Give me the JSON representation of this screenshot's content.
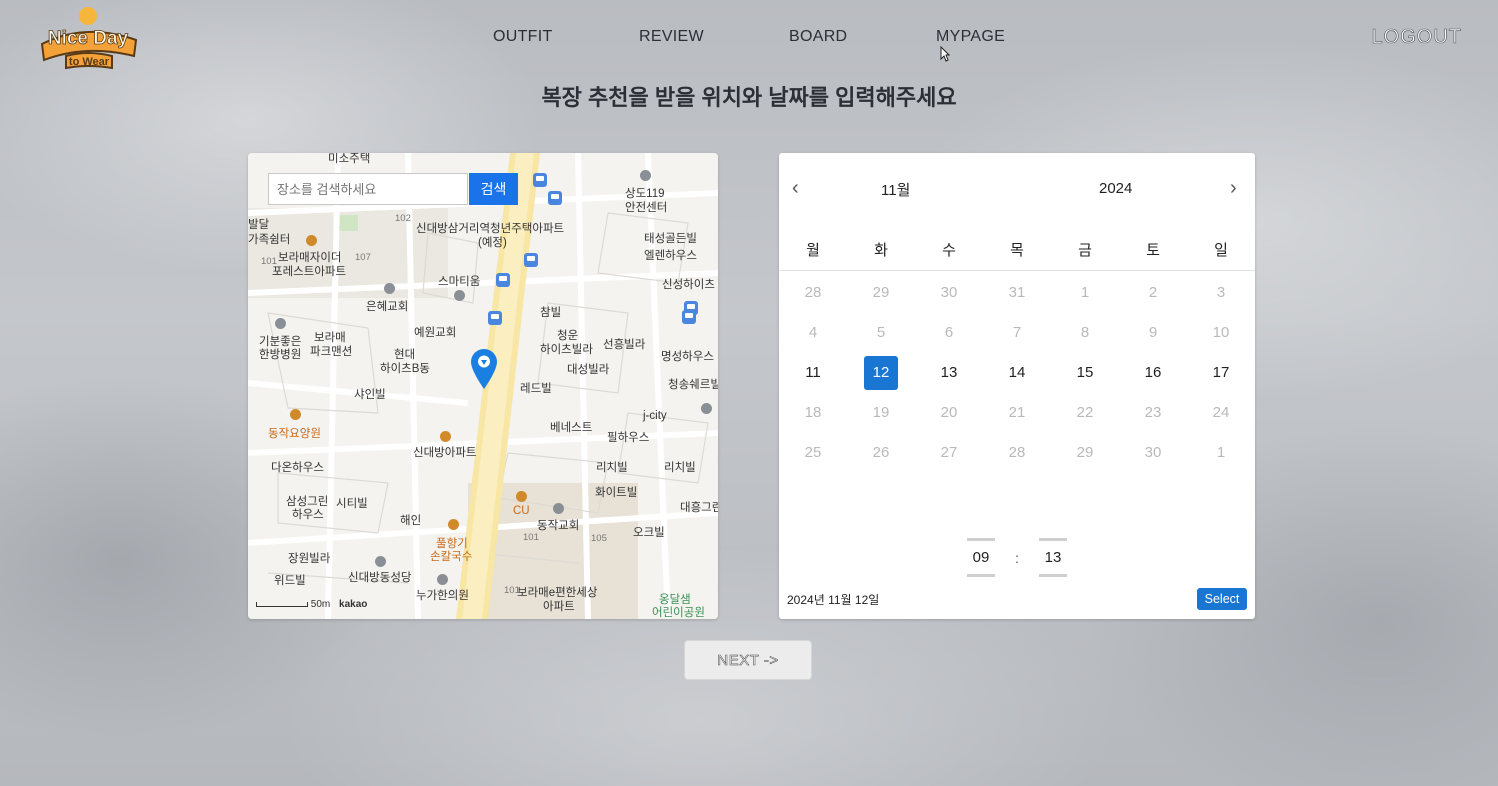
{
  "header": {
    "logo_line1": "Nice Day",
    "logo_line2": "to Wear",
    "nav": [
      "OUTFIT",
      "REVIEW",
      "BOARD",
      "MYPAGE"
    ],
    "logout": "LOGOUT"
  },
  "heading": "복장 추천을 받을 위치와 날짜를 입력해주세요",
  "map": {
    "search_placeholder": "장소를 검색하세요",
    "search_button": "검색",
    "scale_text": "50m",
    "provider": "kakao",
    "labels": [
      "미소주택",
      "발달",
      "가족쉼터",
      "신대방삼거리역청년주택아파트",
      "(예정)",
      "상도119",
      "안전센터",
      "보라매자이더",
      "포레스트아파트",
      "스마티움",
      "태성골든빌",
      "엘렌하우스",
      "은혜교회",
      "신성하이츠",
      "참빌",
      "기분좋은",
      "한방병원",
      "보라매",
      "파크맨션",
      "예원교회",
      "현대",
      "하이츠B동",
      "청운",
      "하이츠빌라",
      "선흥빌라",
      "대성빌라",
      "명성하우스",
      "레드빌",
      "청송쉐르빌",
      "샤인빌",
      "베네스트",
      "j-city",
      "필하우스",
      "동작요양원",
      "신대방아파트",
      "다온하우스",
      "리치빌",
      "리치빌",
      "화이트빌",
      "삼성그린",
      "하우스",
      "시티빌",
      "해인",
      "CU",
      "동작교회",
      "오크빌",
      "대흥그린",
      "풀향기",
      "손칼국수",
      "장원빌라",
      "신대방동성당",
      "보라매e편한세상",
      "아파트",
      "위드빌",
      "누가한의원",
      "옹달샘",
      "어린이공원",
      "102",
      "101",
      "107",
      "105",
      "101",
      "101"
    ]
  },
  "calendar": {
    "month": "11월",
    "year": "2024",
    "weekdays": [
      "월",
      "화",
      "수",
      "목",
      "금",
      "토",
      "일"
    ],
    "weeks": [
      [
        "28",
        "29",
        "30",
        "31",
        "1",
        "2",
        "3"
      ],
      [
        "4",
        "5",
        "6",
        "7",
        "8",
        "9",
        "10"
      ],
      [
        "11",
        "12",
        "13",
        "14",
        "15",
        "16",
        "17"
      ],
      [
        "18",
        "19",
        "20",
        "21",
        "22",
        "23",
        "24"
      ],
      [
        "25",
        "26",
        "27",
        "28",
        "29",
        "30",
        "1"
      ]
    ],
    "selected_day": "12",
    "enabled_days": [
      "12",
      "13",
      "14",
      "15",
      "16",
      "17"
    ],
    "hour": "09",
    "minute": "13",
    "time_separator": ":",
    "selected_text": "2024년 11월 12일",
    "select_button": "Select"
  },
  "next_button": "NEXT ->",
  "colors": {
    "accent": "#1976d2",
    "search_button": "#1a73e8",
    "logo_orange": "#f3a23a"
  }
}
